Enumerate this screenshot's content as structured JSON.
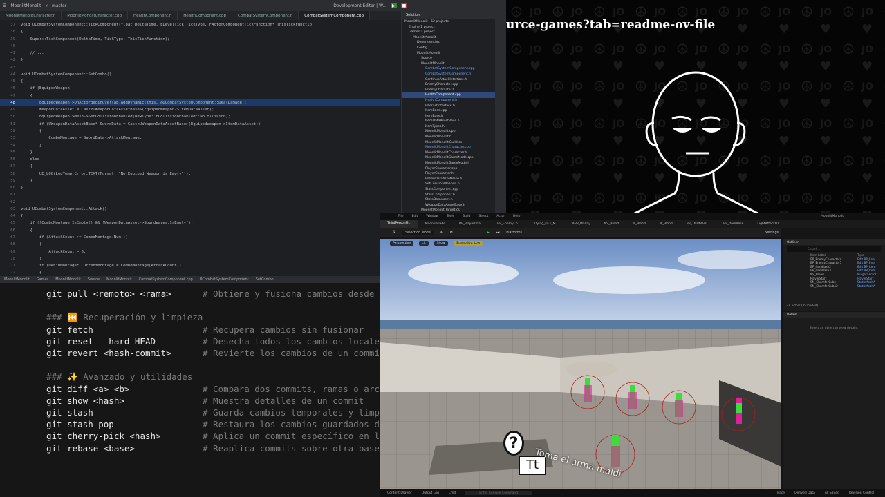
{
  "ide": {
    "title_bar": {
      "project": "MoonlitMonolit",
      "branch": "master",
      "config": "Development Editor | W..."
    },
    "tabs": [
      {
        "label": "MoonlitMonolitCharacter.h",
        "active": false
      },
      {
        "label": "MoonlitMonolitCharacter.cpp",
        "active": false
      },
      {
        "label": "HealthComponent.h",
        "active": false
      },
      {
        "label": "HealthComponent.cpp",
        "active": false
      },
      {
        "label": "CombatSystemComponent.h",
        "active": false
      },
      {
        "label": "CombatSystemComponent.cpp",
        "active": true
      }
    ],
    "code_lines": [
      {
        "n": "37",
        "code": "void UCombatSystemComponent::TickComponent(float DeltaTime, ELevelTick TickType, FActorComponentTickFunction* ThisTickFunctio"
      },
      {
        "n": "38",
        "code": "{"
      },
      {
        "n": "39",
        "code": "    Super::TickComponent(DeltaTime, TickType, ThisTickFunction);"
      },
      {
        "n": "40",
        "code": ""
      },
      {
        "n": "41",
        "code": "    // ..."
      },
      {
        "n": "42",
        "code": "}"
      },
      {
        "n": "43",
        "code": ""
      },
      {
        "n": "44",
        "code": "void UCombatSystemComponent::SetCombo()"
      },
      {
        "n": "45",
        "code": "{"
      },
      {
        "n": "46",
        "code": "    if (EquipedWeapon)"
      },
      {
        "n": "47",
        "code": "    {"
      },
      {
        "n": "48",
        "code": "        EquipedWeapon->OnActorBeginOverlap.AddDynamic(this, &UCombatSystemComponent::DealDamage);",
        "hl": true
      },
      {
        "n": "49",
        "code": "        WeaponDataAsset = Cast<UWeaponDataAssetBase>(EquipedWeapon->ItemDataAsset);"
      },
      {
        "n": "50",
        "code": "        EquipedWeapon->Mesh->SetCollisionEnabled(NewType: ECollisionEnabled::NoCollision);"
      },
      {
        "n": "51",
        "code": "        if (UWeaponDataAssetBase* SwordData = Cast<UWeaponDataAssetBase>(EquipedWeapon->ItemDataAsset))"
      },
      {
        "n": "52",
        "code": "        {"
      },
      {
        "n": "53",
        "code": "            ComboMontage = SwordData->AttackMontage;"
      },
      {
        "n": "54",
        "code": "        }"
      },
      {
        "n": "55",
        "code": "    }"
      },
      {
        "n": "56",
        "code": "    else"
      },
      {
        "n": "57",
        "code": "    {"
      },
      {
        "n": "58",
        "code": "        UE_LOG(LogTemp,Error,TEXT(Format: \"No Equiped Weapon is Empty\"));"
      },
      {
        "n": "59",
        "code": "    }"
      },
      {
        "n": "60",
        "code": "}"
      },
      {
        "n": "61",
        "code": ""
      },
      {
        "n": "62",
        "code": ""
      },
      {
        "n": "63",
        "code": "void UCombatSystemComponent::Attack()"
      },
      {
        "n": "64",
        "code": "{"
      },
      {
        "n": "65",
        "code": "    if (!ComboMontage.IsEmpty() && !WeaponDataAsset->SoundWaves.IsEmpty())"
      },
      {
        "n": "66",
        "code": "    {"
      },
      {
        "n": "67",
        "code": "        if (AttackCount >= ComboMontage.Num())"
      },
      {
        "n": "68",
        "code": "        {"
      },
      {
        "n": "69",
        "code": "            AttackCount = 0;"
      },
      {
        "n": "70",
        "code": "        }"
      },
      {
        "n": "71",
        "code": "        if (UAnimMontage* CurrentMontage = ComboMontage[AttackCount])"
      },
      {
        "n": "72",
        "code": "        {"
      }
    ],
    "breadcrumb": [
      "MoonlitMonolit",
      "Games",
      "MoonlitMonolit",
      "Source",
      "MoonlitMonolit",
      "CombatSystemComponent.cpp",
      "UCombatSystemComponent",
      "SetCombo"
    ],
    "solution": {
      "title": "Solution",
      "items": [
        {
          "label": "MoonlitMonolit · 52 projects",
          "indent": 0
        },
        {
          "label": "Engine  1 project",
          "indent": 1
        },
        {
          "label": "Games  1 project",
          "indent": 1
        },
        {
          "label": "MoonlitMonolit",
          "indent": 2
        },
        {
          "label": "Dependencies",
          "indent": 3
        },
        {
          "label": "Config",
          "indent": 3
        },
        {
          "label": "MoonlitMonolit",
          "indent": 3
        },
        {
          "label": "Source",
          "indent": 4
        },
        {
          "label": "MoonlitMonolit",
          "indent": 4
        },
        {
          "label": "CombatSystemComponent.cpp",
          "indent": 5,
          "blue": true
        },
        {
          "label": "CombatSystemComponent.h",
          "indent": 5,
          "blue": true
        },
        {
          "label": "ContinueAttackInterface.h",
          "indent": 5
        },
        {
          "label": "EnemyCharacter.cpp",
          "indent": 5
        },
        {
          "label": "EnemyCharacter.h",
          "indent": 5
        },
        {
          "label": "HealthComponent.cpp",
          "indent": 5,
          "sel": true
        },
        {
          "label": "HealthComponent.h",
          "indent": 5,
          "blue": true
        },
        {
          "label": "InteractInterface.h",
          "indent": 5
        },
        {
          "label": "ItemBase.cpp",
          "indent": 5
        },
        {
          "label": "ItemBase.h",
          "indent": 5
        },
        {
          "label": "ItemDataAssetBase.h",
          "indent": 5
        },
        {
          "label": "ItemTypes.h",
          "indent": 5
        },
        {
          "label": "MoonlitMonolit.cpp",
          "indent": 5
        },
        {
          "label": "MoonlitMonolit.h",
          "indent": 5
        },
        {
          "label": "MoonlitMonolit.Build.cs",
          "indent": 5
        },
        {
          "label": "MoonlitMonolitCharacter.cpp",
          "indent": 5,
          "blue": true
        },
        {
          "label": "MoonlitMonolitCharacter.h",
          "indent": 5
        },
        {
          "label": "MoonlitMonolitGameMode.cpp",
          "indent": 5
        },
        {
          "label": "MoonlitMonolitGameMode.h",
          "indent": 5
        },
        {
          "label": "PlayerCharacter.cpp",
          "indent": 5
        },
        {
          "label": "PlayerCharacter.h",
          "indent": 5
        },
        {
          "label": "PotionDataAssetBase.h",
          "indent": 5
        },
        {
          "label": "SetCollisionWeapon.h",
          "indent": 5
        },
        {
          "label": "StatsComponent.cpp",
          "indent": 5
        },
        {
          "label": "StatsComponent.h",
          "indent": 5
        },
        {
          "label": "StatsDataAsset.h",
          "indent": 5
        },
        {
          "label": "WeaponDataAssetBase.h",
          "indent": 5
        },
        {
          "label": "MoonlitMonolit.Target.cs",
          "indent": 4
        },
        {
          "label": "MoonlitMonolitEditor.Target.cs",
          "indent": 4
        }
      ]
    }
  },
  "terminal": {
    "lines": [
      {
        "type": "cmd",
        "cmd": "git pull <remoto> <rama>",
        "comment": "# Obtiene y fusiona cambios desde"
      },
      {
        "type": "blank"
      },
      {
        "type": "head",
        "text": "### ⏮️ Recuperación y limpieza"
      },
      {
        "type": "cmd",
        "cmd": "git fetch",
        "comment": "# Recupera cambios sin fusionar"
      },
      {
        "type": "cmd",
        "cmd": "git reset --hard HEAD",
        "comment": "# Desecha todos los cambios locale"
      },
      {
        "type": "cmd",
        "cmd": "git revert <hash-commit>",
        "comment": "# Revierte los cambios de un commi"
      },
      {
        "type": "blank"
      },
      {
        "type": "head",
        "text": "### ✨ Avanzado y utilidades"
      },
      {
        "type": "cmd",
        "cmd": "git diff <a> <b>",
        "comment": "# Compara dos commits, ramas o arc"
      },
      {
        "type": "cmd",
        "cmd": "git show <hash>",
        "comment": "# Muestra detalles de un commit"
      },
      {
        "type": "cmd",
        "cmd": "git stash",
        "comment": "# Guarda cambios temporales y limp"
      },
      {
        "type": "cmd",
        "cmd": "git stash pop",
        "comment": "# Restaura los cambios guardados d"
      },
      {
        "type": "cmd",
        "cmd": "git cherry-pick <hash>",
        "comment": "# Aplica un commit específico en l"
      },
      {
        "type": "cmd",
        "cmd": "git rebase <base>",
        "comment": "# Reaplica commits sobre otra base"
      }
    ]
  },
  "video": {
    "url_text": "urce-games?tab=readme-ov-file"
  },
  "unreal": {
    "project": "MoonlitMonolit",
    "menu": [
      "File",
      "Edit",
      "Window",
      "Tools",
      "Build",
      "Select",
      "Actor",
      "Help"
    ],
    "tabs": [
      "ThirdPersonM...",
      "MoonlitBlade",
      "BP_PlayerCha...",
      "BP_EnemyCh...",
      "Dying_UE1_M...",
      "ABP_Manny",
      "NS_Blood",
      "M_Blood",
      "M_Blood",
      "BP_ThirdPers...",
      "BP_ItemBase",
      "LightAttack01"
    ],
    "toolbar": {
      "mode": "Selection Mode",
      "platforms": "Platforms",
      "settings": "Settings"
    },
    "viewport": {
      "perspective": "Perspective",
      "lit": "Lit",
      "show": "Show",
      "scalability": "Scalability: Low"
    },
    "outliner": {
      "title": "Outliner",
      "search": "Search...",
      "col_label": "Item Label",
      "col_type": "Type",
      "rows": [
        {
          "label": "BP_EnemyCharacter4",
          "type": "Edit BP_Ene"
        },
        {
          "label": "BP_EnemyCharacter5",
          "type": "Edit BP_Ene"
        },
        {
          "label": "BP_ItemBase2",
          "type": "Edit BP_Item"
        },
        {
          "label": "BP_ItemBase3",
          "type": "Edit BP_Item"
        },
        {
          "label": "NS_Blood",
          "type": "NiagaraActor"
        },
        {
          "label": "PlayerStart",
          "type": "PlayerStart"
        },
        {
          "label": "SM_ChamferCube",
          "type": "StaticMeshA"
        },
        {
          "label": "SM_ChamferCube2",
          "type": "StaticMeshA"
        }
      ],
      "count": "49 actors (45 loaded)"
    },
    "details": {
      "title": "Details",
      "empty": "Select an object to view details."
    },
    "bottom": [
      "Content Drawer",
      "Output Log",
      "Cmd",
      "Trace",
      "Derived Data",
      "All Saved",
      "Revision Control"
    ],
    "console_placeholder": "Enter Console Command"
  },
  "subtitle": "Toma el arma maldi",
  "colors": {
    "accent": "#2f6fd6",
    "highlight": "#1b3a6b",
    "enemy_pink": "#e0209a",
    "player_green": "#3bdc3b"
  }
}
